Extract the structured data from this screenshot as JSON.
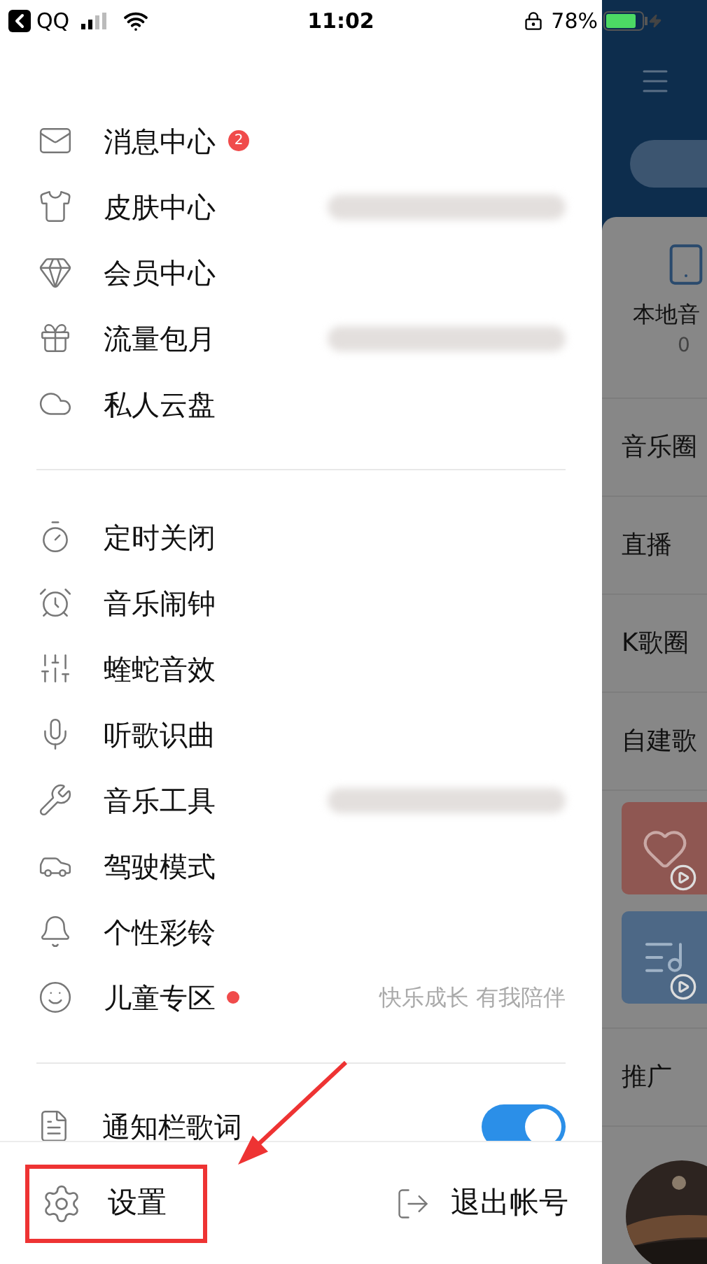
{
  "status_bar": {
    "back_app": "QQ",
    "time": "11:02",
    "battery": "78%"
  },
  "menu_sections": [
    {
      "items": [
        {
          "label": "消息中心",
          "badge": "2"
        },
        {
          "label": "皮肤中心",
          "redacted": true
        },
        {
          "label": "会员中心"
        },
        {
          "label": "流量包月",
          "redacted": true
        },
        {
          "label": "私人云盘"
        }
      ]
    },
    {
      "items": [
        {
          "label": "定时关闭"
        },
        {
          "label": "音乐闹钟"
        },
        {
          "label": "蝰蛇音效"
        },
        {
          "label": "听歌识曲"
        },
        {
          "label": "音乐工具",
          "redacted": true
        },
        {
          "label": "驾驶模式"
        },
        {
          "label": "个性彩铃"
        },
        {
          "label": "儿童专区",
          "dot": true,
          "note": "快乐成长 有我陪伴"
        }
      ]
    }
  ],
  "toggle_row": {
    "label": "通知栏歌词",
    "on": true
  },
  "footer": {
    "settings": {
      "label": "设置",
      "highlighted": true
    },
    "logout": {
      "label": "退出帐号"
    }
  },
  "background_app": {
    "local": {
      "label": "本地音",
      "count": "0"
    },
    "rows": [
      {
        "kind": "text",
        "label": "音乐圈"
      },
      {
        "kind": "text",
        "label": "直播"
      },
      {
        "kind": "text",
        "label": "K歌圈"
      },
      {
        "kind": "text",
        "label": "自建歌"
      },
      {
        "kind": "heart_card"
      },
      {
        "kind": "note_card"
      },
      {
        "kind": "text",
        "label": "推广"
      }
    ]
  }
}
